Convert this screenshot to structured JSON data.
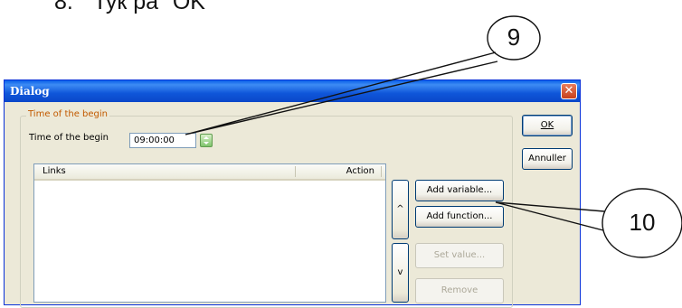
{
  "document": {
    "step_number": "8.",
    "step_text": "Тук ра \"OK\""
  },
  "callouts": [
    {
      "label": "9"
    },
    {
      "label": "10"
    }
  ],
  "dialog": {
    "title": "Dialog",
    "close_glyph": "✕",
    "group_title": "Time of the begin",
    "time_label": "Time of the begin",
    "time_value": "09:00:00",
    "list": {
      "columns": [
        "Links",
        "Action"
      ],
      "rows": []
    },
    "up_arrow": "^",
    "down_arrow": "v",
    "buttons": {
      "add_variable": "Add variable...",
      "add_function": "Add function...",
      "set_value": "Set value...",
      "remove": "Remove",
      "ok": "OK",
      "cancel": "Annuller"
    },
    "icons": {
      "spin": "spin-arrows-icon",
      "close": "close-icon"
    }
  }
}
